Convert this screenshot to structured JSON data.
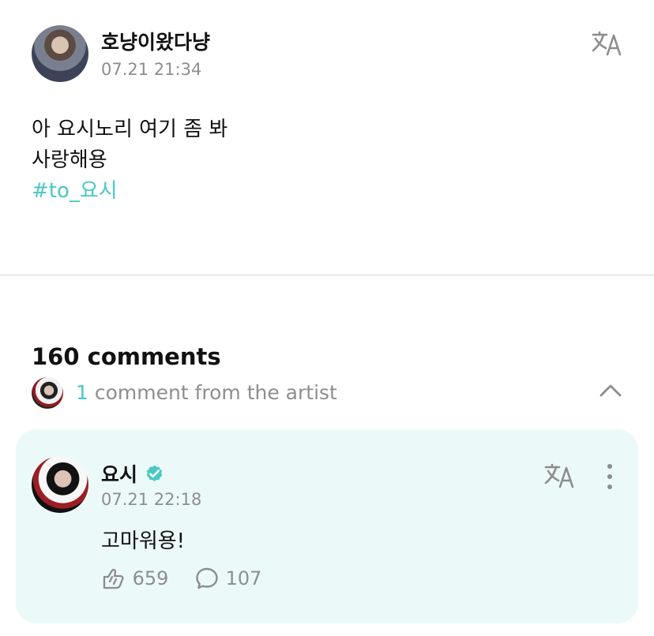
{
  "post": {
    "author": "호냥이왔다냥",
    "timestamp": "07.21 21:34",
    "lines": [
      "아 요시노리 여기 좀 봐",
      "사랑해용"
    ],
    "hashtag": "#to_요시",
    "translate_icon": "translate-icon"
  },
  "comments": {
    "title": "160 comments",
    "artist_summary": {
      "count": "1",
      "label": "comment from the artist",
      "collapse_icon": "chevron-up-icon"
    }
  },
  "artist_comment": {
    "author": "요시",
    "timestamp": "07.21 22:18",
    "text": "고마워용!",
    "likes": "659",
    "replies": "107",
    "verified_icon": "verified-icon",
    "translate_icon": "translate-icon",
    "more_icon": "more-icon"
  },
  "colors": {
    "accent": "#49c8c4",
    "muted": "#8e8e8e",
    "card_background": "#ebfaf8"
  }
}
